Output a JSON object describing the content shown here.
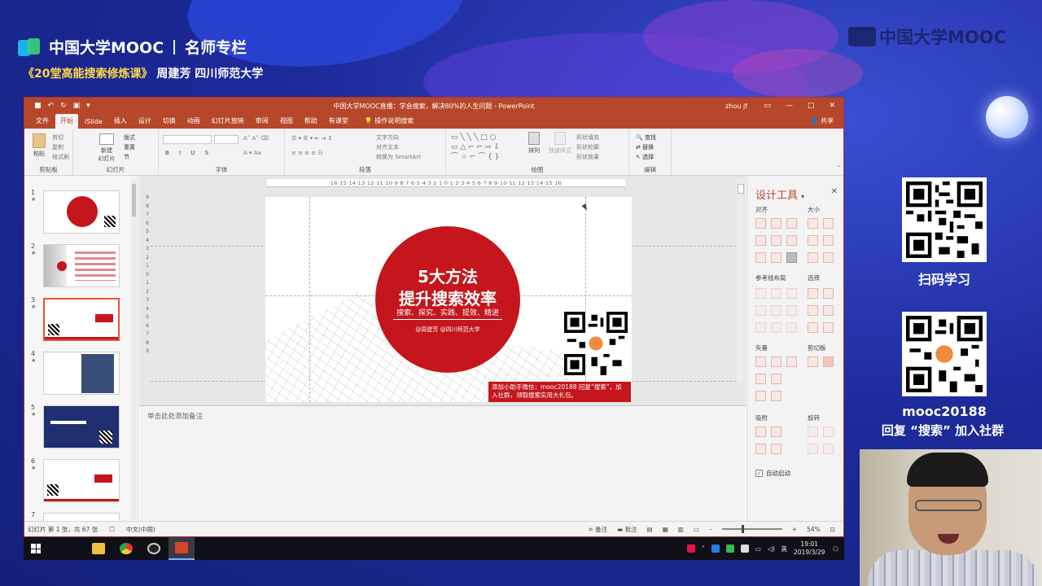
{
  "stream": {
    "brand": "中国大学MOOC",
    "brand_suffix": "名师专栏",
    "course": "《20堂高能搜索修炼课》",
    "teacher": "周建芳",
    "university": "四川师范大学",
    "watermark": "中国大学MOOC",
    "scan_label": "扫码学习",
    "wechat_id": "mooc20188",
    "reply_label": "回复 “搜索” 加入社群"
  },
  "window": {
    "title": "中国大学MOOC直播：学会搜索，解决80%的人生问题 - PowerPoint",
    "user": "zhou jf"
  },
  "menu": {
    "items": [
      "文件",
      "开始",
      "iSlide",
      "插入",
      "设计",
      "切换",
      "动画",
      "幻灯片放映",
      "审阅",
      "视图",
      "帮助",
      "有课堂"
    ],
    "active": "开始",
    "tell_me": "操作说明搜索",
    "share": "共享"
  },
  "ribbon": {
    "clipboard": {
      "label": "剪贴板",
      "paste": "粘贴",
      "cut": "剪切",
      "copy": "复制",
      "format": "格式刷"
    },
    "slides": {
      "label": "幻灯片",
      "new": "新建\n幻灯片",
      "layout": "版式",
      "reset": "重置",
      "section": "节"
    },
    "font": {
      "label": "字体"
    },
    "paragraph": {
      "label": "段落",
      "dir": "文字方向",
      "align": "对齐文本",
      "smartart": "转换为 SmartArt"
    },
    "drawing": {
      "label": "绘图",
      "arrange": "排列",
      "quick": "快速样式",
      "fill": "形状填充",
      "outline": "形状轮廓",
      "effect": "形状效果"
    },
    "editing": {
      "label": "编辑",
      "find": "查找",
      "replace": "替换",
      "select": "选择"
    }
  },
  "thumbnails": [
    {
      "num": "1",
      "star": "★"
    },
    {
      "num": "2",
      "star": "★"
    },
    {
      "num": "3",
      "star": "★"
    },
    {
      "num": "4",
      "star": "★"
    },
    {
      "num": "5",
      "star": "★"
    },
    {
      "num": "6",
      "star": "★"
    },
    {
      "num": "7",
      "star": ""
    }
  ],
  "ruler": {
    "horizontal": "·16·15·14·13·12·11·10·9·8·7·6·5·4·3·2·1·0·1·2·3·4·5·6·7·8·9·10·11·12·13·14·15·16·",
    "vertical": "9 8 7 6 5 4 3 2 1 0 1 2 3 4 5 6 7 8 9"
  },
  "slide": {
    "title_line1": "5大方法",
    "title_line2": "提升搜索效率",
    "keywords": "搜索、探究、实践、提效、精进",
    "authors": "@周建芳   @四川师范大学",
    "banner": "添加小助手微信：mooc20188 回复“搜索”，加入社群，领取搜索实用大礼包。"
  },
  "notes_placeholder": "单击此处添加备注",
  "design_pane": {
    "title": "设计工具",
    "align": "对齐",
    "size": "大小",
    "guides": "参考线布局",
    "select": "选择",
    "vector": "矢量",
    "clip": "剪切板",
    "snap": "吸附",
    "rotate": "旋转",
    "auto_start": "自动启动"
  },
  "status": {
    "slide_info": "幻灯片 第 1 张，共 67 张",
    "language": "中文(中国)",
    "notes": "备注",
    "comments": "批注",
    "zoom": "54%"
  },
  "taskbar": {
    "time": "19:01",
    "date": "2019/3/29",
    "ime": "英"
  },
  "colors": {
    "ppt_red": "#b7472a",
    "slide_red": "#c4161c",
    "stream_blue": "#1d2a9a"
  }
}
